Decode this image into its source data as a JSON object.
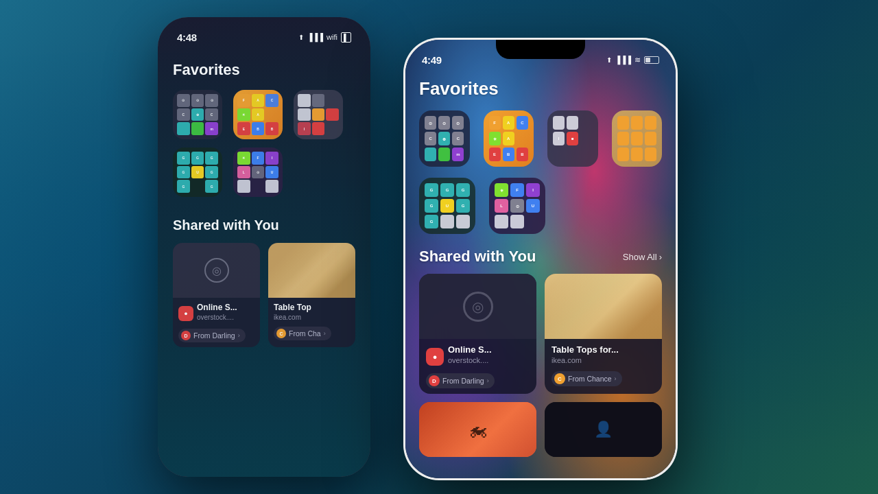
{
  "background": {
    "gradient": "linear-gradient(135deg, #1a6b8a 0%, #0d4a6b 30%, #0a3d55 60%, #1a5c4a 100%)"
  },
  "phone_back": {
    "time": "4:48",
    "location_arrow": true,
    "favorites_title": "Favorites",
    "shared_with_you_title": "Shared with You",
    "cards": [
      {
        "title": "Online S...",
        "subtitle": "overstock....",
        "from": "From Darling",
        "from_type": "red",
        "has_compass": true
      },
      {
        "title": "Table Top",
        "subtitle": "ikea.com",
        "from": "From Cha",
        "from_type": "orange",
        "has_wood": true
      }
    ]
  },
  "phone_front": {
    "time": "4:49",
    "location_arrow": true,
    "battery_percent": 40,
    "favorites_title": "Favorites",
    "shared_with_you_title": "Shared with You",
    "show_all": "Show All",
    "cards": [
      {
        "title": "Online S...",
        "subtitle": "overstock....",
        "from": "From Darling",
        "from_type": "red",
        "has_compass": true
      },
      {
        "title": "Table Tops for...",
        "subtitle": "ikea.com",
        "from": "From Chance",
        "from_type": "orange",
        "has_wood": true
      }
    ]
  }
}
